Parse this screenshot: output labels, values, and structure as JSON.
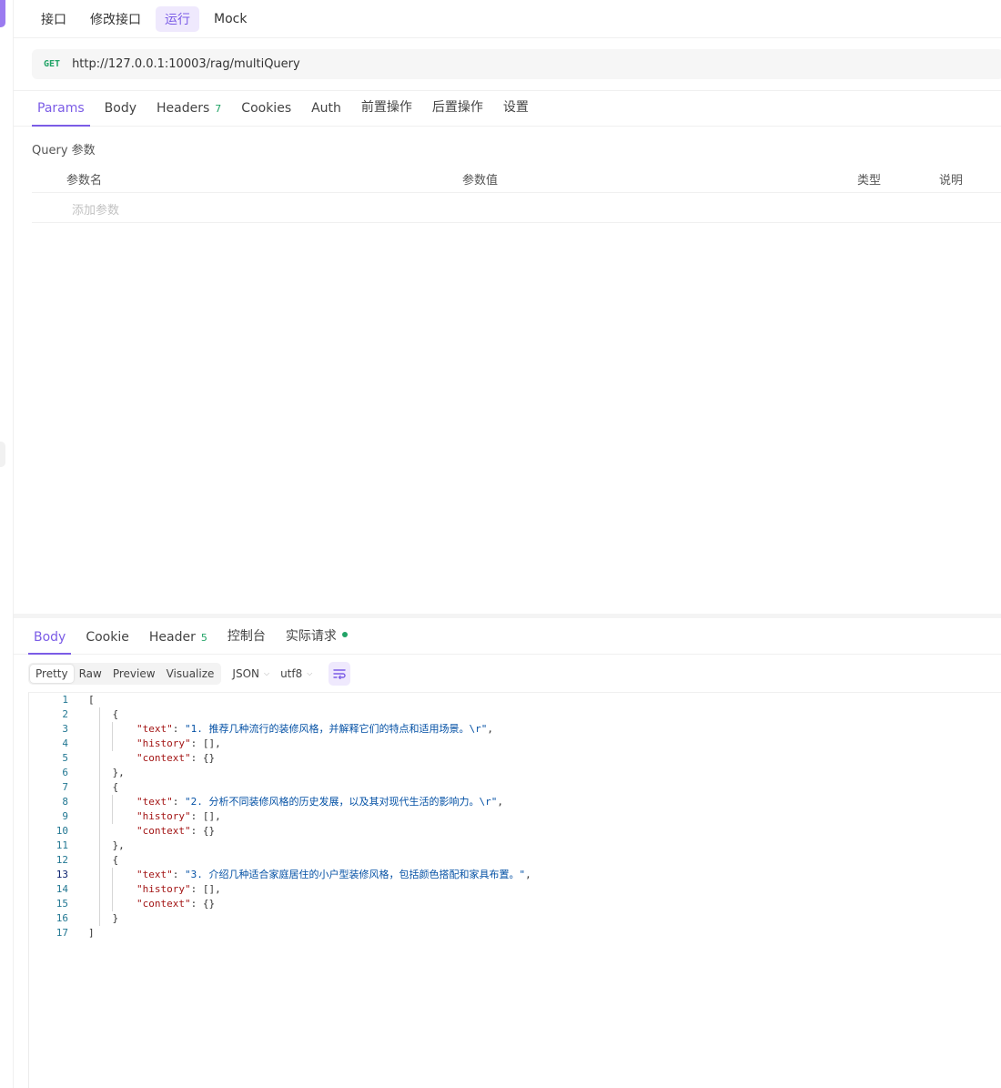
{
  "top_tabs": [
    "接口",
    "修改接口",
    "运行",
    "Mock"
  ],
  "top_tab_active": "运行",
  "request": {
    "method": "GET",
    "url": "http://127.0.0.1:10003/rag/multiQuery"
  },
  "request_tabs": {
    "params": "Params",
    "body": "Body",
    "headers": "Headers",
    "headers_count": "7",
    "cookies": "Cookies",
    "auth": "Auth",
    "pre": "前置操作",
    "post": "后置操作",
    "settings": "设置"
  },
  "query": {
    "title": "Query 参数",
    "columns": {
      "name": "参数名",
      "value": "参数值",
      "type": "类型",
      "desc": "说明"
    },
    "add_placeholder": "添加参数"
  },
  "response_tabs": {
    "body": "Body",
    "cookie": "Cookie",
    "header": "Header",
    "header_count": "5",
    "console": "控制台",
    "actual": "实际请求"
  },
  "toolbar": {
    "views": [
      "Pretty",
      "Raw",
      "Preview",
      "Visualize"
    ],
    "active_view": "Pretty",
    "format": "JSON",
    "encoding": "utf8"
  },
  "response_lines": [
    "[",
    "    {",
    "        \"text\": \"1. 推荐几种流行的装修风格，并解释它们的特点和适用场景。\\r\",",
    "        \"history\": [],",
    "        \"context\": {}",
    "    },",
    "    {",
    "        \"text\": \"2. 分析不同装修风格的历史发展，以及其对现代生活的影响力。\\r\",",
    "        \"history\": [],",
    "        \"context\": {}",
    "    },",
    "    {",
    "        \"text\": \"3. 介绍几种适合家庭居住的小户型装修风格，包括颜色搭配和家具布置。\",",
    "        \"history\": [],",
    "        \"context\": {}",
    "    }",
    "]"
  ],
  "current_line": 13,
  "colors": {
    "accent": "#7b5ce6",
    "method_get": "#21a366",
    "json_key": "#a31515",
    "json_string": "#0451a5",
    "line_number": "#237893"
  },
  "icons": {
    "wrap": "word-wrap-icon",
    "chevron": "chevron-down-icon",
    "status": "green-dot-icon"
  }
}
